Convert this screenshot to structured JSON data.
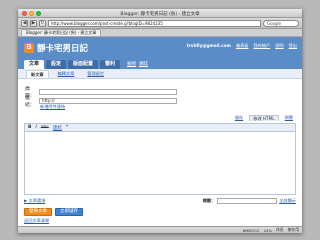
{
  "browser": {
    "window_title": "Blogger: 靜卡宅男日記 (負) - 建立文章",
    "url": "http://www.blogger.com/post-create.g?blogID=9824235",
    "search_placeholder": "Google",
    "tab_title": "Blogger: 靜卡宅男日記 (負) - 建立文章",
    "nav_back": "◀",
    "nav_forward": "▶",
    "nav_reload": "↻"
  },
  "header": {
    "logo_letter": "B",
    "blog_title": "靜卡宅男日記",
    "user_email": "trvhfly@gmail.com",
    "links": [
      "儀表板",
      "我的帳戶",
      "說明",
      "登出"
    ]
  },
  "main_tabs": [
    {
      "label": "文章",
      "active": true
    },
    {
      "label": "設定",
      "active": false
    },
    {
      "label": "版面配置",
      "active": false
    },
    {
      "label": "營利",
      "active": false
    }
  ],
  "view_links": [
    "檢視",
    "網誌"
  ],
  "sub_tabs": [
    {
      "label": "新文章",
      "active": true
    },
    {
      "label": "編輯文章",
      "active": false
    },
    {
      "label": "管理留言",
      "active": false
    }
  ],
  "form": {
    "title_label": "標題：",
    "title_value": "",
    "link_label": "連結：",
    "link_value": "http://",
    "link_settings": "新增附件連結",
    "editor_tabs": [
      {
        "label": "儲存",
        "active": false
      },
      {
        "label": "修改 HTML",
        "active": true
      },
      {
        "label": "預覽",
        "active": false
      }
    ],
    "toolbar": {
      "bold": "B",
      "italic": "I",
      "strike": "abc",
      "link": "連結",
      "quote": "❝"
    },
    "post_options": "▶ 文章選項",
    "labels_label": "標籤：",
    "show_all": "全部顯示",
    "publish_button": "發佈文章",
    "save_button": "立即儲存",
    "return_link": "返回文章清單"
  },
  "status": {
    "left": "",
    "items": [
      "8MB/512",
      "24%",
      "休息",
      "無作用"
    ]
  }
}
